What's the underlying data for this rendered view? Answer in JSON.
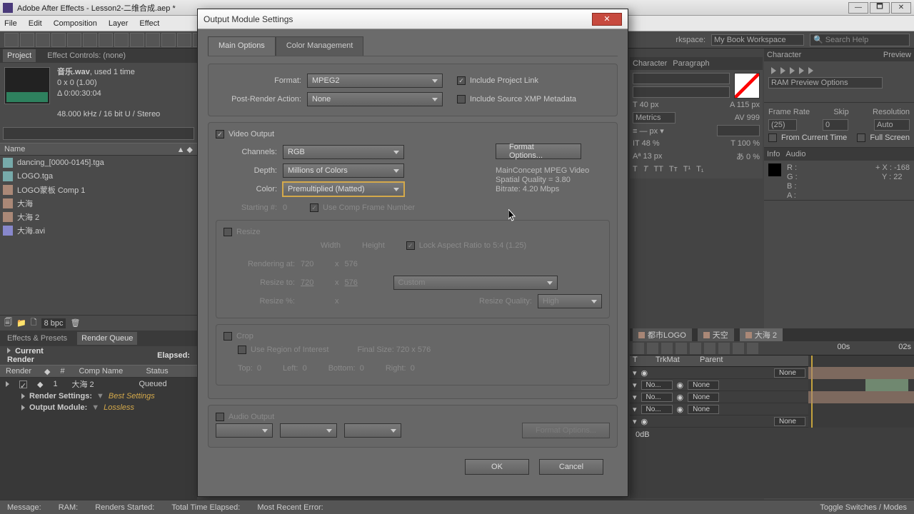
{
  "titlebar": {
    "title": "Adobe After Effects - Lesson2-二维合成.aep *"
  },
  "winbtns": {
    "min": "—",
    "max": "🗖",
    "close": "✕"
  },
  "menu": [
    "File",
    "Edit",
    "Composition",
    "Layer",
    "Effect"
  ],
  "toolbar": {
    "workspace_lbl": "rkspace:",
    "workspace": "My Book Workspace",
    "search_ph": "Search Help"
  },
  "project": {
    "tab_project": "Project",
    "tab_effect_controls": "Effect Controls: (none)",
    "item_name": "音乐.wav",
    "used": ", used 1 time",
    "dim": "0 x 0 (1.00)",
    "dur": "Δ 0:00:30:04",
    "audio": "48.000 kHz / 16 bit U / Stereo",
    "col_name": "Name",
    "items": [
      {
        "name": "dancing_[0000-0145].tga",
        "icon": "ico-img"
      },
      {
        "name": "LOGO.tga",
        "icon": "ico-img"
      },
      {
        "name": "LOGO蒙板 Comp 1",
        "icon": "ico-comp"
      },
      {
        "name": "大海",
        "icon": "ico-comp"
      },
      {
        "name": "大海 2",
        "icon": "ico-comp"
      },
      {
        "name": "大海.avi",
        "icon": "ico-vid"
      }
    ],
    "bpc": "8 bpc"
  },
  "effects_tab": "Effects & Presets",
  "renderq_tab": "Render Queue",
  "render": {
    "current": "Current Render",
    "elapsed": "Elapsed:",
    "cols": {
      "render": "Render",
      "num": "#",
      "comp": "Comp Name",
      "status": "Status"
    },
    "item": {
      "num": "1",
      "comp": "大海 2",
      "status": "Queued"
    },
    "rs_label": "Render Settings:",
    "rs_value": "Best Settings",
    "om_label": "Output Module:",
    "om_value": "Lossless"
  },
  "rightpanels": {
    "char": "Character",
    "para": "Paragraph",
    "preview": "Preview",
    "ram": "RAM Preview Options",
    "fr": "Frame Rate",
    "skip": "Skip",
    "res": "Resolution",
    "fr_v": "(25)",
    "skip_v": "0",
    "res_v": "Auto",
    "fct": "From Current Time",
    "fs": "Full Screen",
    "info": "Info",
    "audio": "Audio",
    "r": "R :",
    "g": "G :",
    "b": "B :",
    "a": "A :",
    "x": "X : -168",
    "y": "Y : 22",
    "fontsize": "40 px",
    "leading": "115 px",
    "metrics": "Metrics",
    "av": "999",
    "pct1": "48 %",
    "pct2": "100 %",
    "pct3": "13 px",
    "pct4": "0 %"
  },
  "timeline": {
    "tab1": "都市LOGO",
    "tab2": "天空",
    "tab3": "大海 2",
    "col_t": "T",
    "col_trk": "TrkMat",
    "col_parent": "Parent",
    "none_s": "No...",
    "none": "None",
    "t1": "00s",
    "t2": "02s",
    "db": "0dB"
  },
  "dialog": {
    "title": "Output Module Settings",
    "tab_main": "Main Options",
    "tab_color": "Color Management",
    "format_lbl": "Format:",
    "format": "MPEG2",
    "include_link": "Include Project Link",
    "pra_lbl": "Post-Render Action:",
    "pra": "None",
    "include_xmp": "Include Source XMP Metadata",
    "video_output": "Video Output",
    "channels_lbl": "Channels:",
    "channels": "RGB",
    "format_options": "Format Options...",
    "depth_lbl": "Depth:",
    "depth": "Millions of Colors",
    "color_lbl": "Color:",
    "color_v": "Premultiplied (Matted)",
    "codec1": "MainConcept MPEG Video",
    "codec2": "Spatial Quality = 3.80",
    "codec3": "Bitrate: 4.20 Mbps",
    "start_lbl": "Starting #:",
    "start_v": "0",
    "use_comp": "Use Comp Frame Number",
    "resize": "Resize",
    "width": "Width",
    "height": "Height",
    "lock": "Lock Aspect Ratio to 5:4 (1.25)",
    "render_at": "Rendering at:",
    "r_w": "720",
    "x": "x",
    "r_h": "576",
    "resize_to": "Resize to:",
    "rt_w": "720",
    "rt_h": "576",
    "rt_preset": "Custom",
    "resize_pct": "Resize %:",
    "resize_q": "Resize Quality:",
    "resize_q_v": "High",
    "crop": "Crop",
    "roi": "Use Region of Interest",
    "final": "Final Size: 720 x 576",
    "top": "Top:",
    "left": "Left:",
    "bottom": "Bottom:",
    "right": "Right:",
    "zero": "0",
    "audio_output": "Audio Output",
    "format_options2": "Format Options...",
    "ok": "OK",
    "cancel": "Cancel"
  },
  "status": {
    "msg": "Message:",
    "ram": "RAM:",
    "rs": "Renders Started:",
    "tte": "Total Time Elapsed:",
    "mre": "Most Recent Error:",
    "toggle": "Toggle Switches / Modes"
  }
}
